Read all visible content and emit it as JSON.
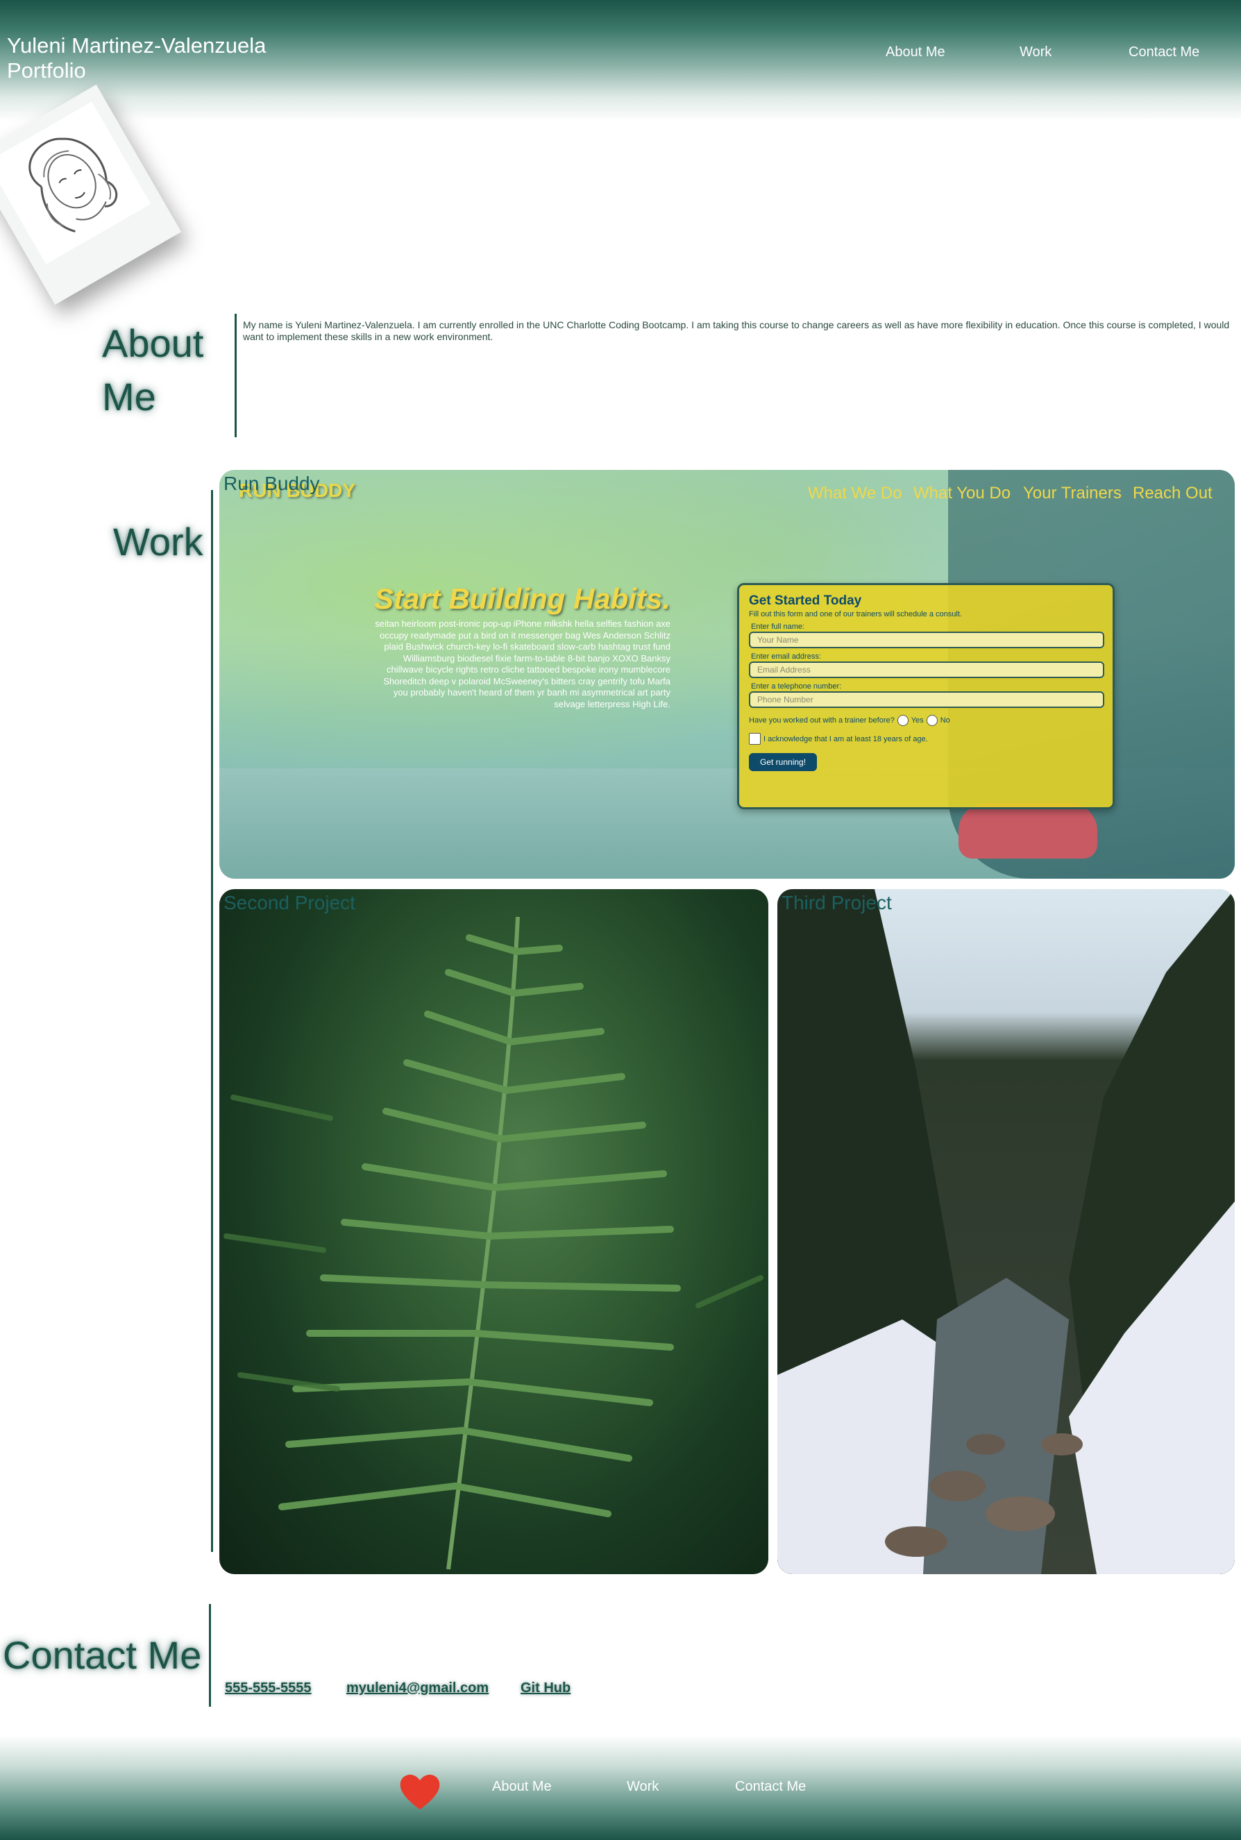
{
  "header": {
    "name": "Yuleni Martinez-Valenzuela",
    "subtitle": "Portfolio",
    "nav": [
      "About Me",
      "Work",
      "Contact Me"
    ]
  },
  "about": {
    "title_line1": "About",
    "title_line2": "Me",
    "text": "My name is Yuleni Martinez-Valenzuela. I am currently enrolled in the UNC Charlotte Coding Bootcamp. I am taking this course to change careers as well as have more flexibility in education. Once this course is completed, I would want to implement these skills in a new work environment."
  },
  "work": {
    "title": "Work",
    "projects": [
      {
        "label": "Run Buddy"
      },
      {
        "label": "Second Project"
      },
      {
        "label": "Third Project"
      }
    ],
    "run_buddy": {
      "logo": "RUN BUDDY",
      "nav": [
        "What We Do",
        "What You Do",
        "Your Trainers",
        "Reach Out"
      ],
      "hero_title": "Start Building Habits.",
      "hero_text": "seitan heirloom post-ironic pop-up iPhone mlkshk hella selfies fashion axe occupy readymade put a bird on it messenger bag Wes Anderson Schlitz plaid Bushwick church-key lo-fi skateboard slow-carb hashtag trust fund Williamsburg biodiesel fixie farm-to-table 8-bit banjo XOXO Banksy chillwave bicycle rights retro cliche tattooed bespoke irony mumblecore Shoreditch deep v polaroid McSweeney's bitters cray gentrify tofu Marfa you probably haven't heard of them yr banh mi asymmetrical art party selvage letterpress High Life.",
      "form": {
        "title": "Get Started Today",
        "subtitle": "Fill out this form and one of our trainers will schedule a consult.",
        "name_label": "Enter full name:",
        "name_placeholder": "Your Name",
        "email_label": "Enter email address:",
        "email_placeholder": "Email Address",
        "phone_label": "Enter a telephone number:",
        "phone_placeholder": "Phone Number",
        "trainer_question": "Have you worked out with a trainer before?",
        "yes": "Yes",
        "no": "No",
        "age_ack": "I acknowledge that I am at least 18 years of age.",
        "submit": "Get running!"
      }
    }
  },
  "contact": {
    "title": "Contact Me",
    "phone": "555-555-5555",
    "email": "myuleni4@gmail.com",
    "github": "Git Hub"
  },
  "footer": {
    "nav": [
      "About Me",
      "Work",
      "Contact Me"
    ]
  },
  "colors": {
    "brand_green": "#1c5448",
    "run_buddy_yellow": "#f0d84a",
    "heart_red": "#e83a2a"
  }
}
